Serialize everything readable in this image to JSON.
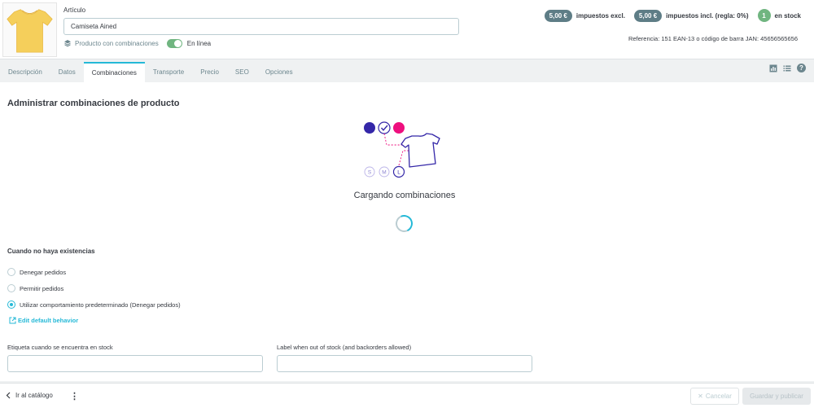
{
  "header": {
    "article_label": "Artículo",
    "product_name": "Camiseta Ained",
    "combinations_label": "Producto con combinaciones",
    "online_label": "En línea",
    "price_excl": "5,00 €",
    "price_excl_label": "impuestos excl.",
    "price_incl": "5,00 €",
    "price_incl_label": "impuestos incl. (regla: 0%)",
    "stock_count": "1",
    "stock_label": "en stock",
    "reference_line": "Referencia: 151  EAN-13 o código de barra JAN: 45656565656",
    "online_toggle_on": true
  },
  "tabs": [
    {
      "label": "Descripción",
      "active": false
    },
    {
      "label": "Datos",
      "active": false
    },
    {
      "label": "Combinaciones",
      "active": true
    },
    {
      "label": "Transporte",
      "active": false
    },
    {
      "label": "Precio",
      "active": false
    },
    {
      "label": "SEO",
      "active": false
    },
    {
      "label": "Opciones",
      "active": false
    }
  ],
  "main": {
    "title": "Administrar combinaciones de producto",
    "loading_text": "Cargando combinaciones",
    "illustration_sizes": [
      "S",
      "M",
      "L"
    ],
    "out_of_stock": {
      "title": "Cuando no haya existencias",
      "options": [
        {
          "label": "Denegar pedidos",
          "checked": false
        },
        {
          "label": "Permitir pedidos",
          "checked": false
        },
        {
          "label": "Utilizar comportamiento predeterminado (Denegar pedidos)",
          "checked": true
        }
      ],
      "edit_link": "Edit default behavior"
    },
    "label_in_stock": "Etiqueta cuando se encuentra en stock",
    "label_out_of_stock": "Label when out of stock (and backorders allowed)",
    "label_in_stock_value": "",
    "label_out_of_stock_value": ""
  },
  "footer": {
    "back_label": "Ir al catálogo",
    "more_label": "⋮",
    "cancel_label": "Cancelar",
    "save_label": "Guardar y publicar"
  },
  "colors": {
    "accent": "#25b9d7",
    "success": "#70b580",
    "badge": "#5e7d86",
    "illustration_blue": "#3427a8",
    "illustration_pink": "#ee0f7e"
  }
}
